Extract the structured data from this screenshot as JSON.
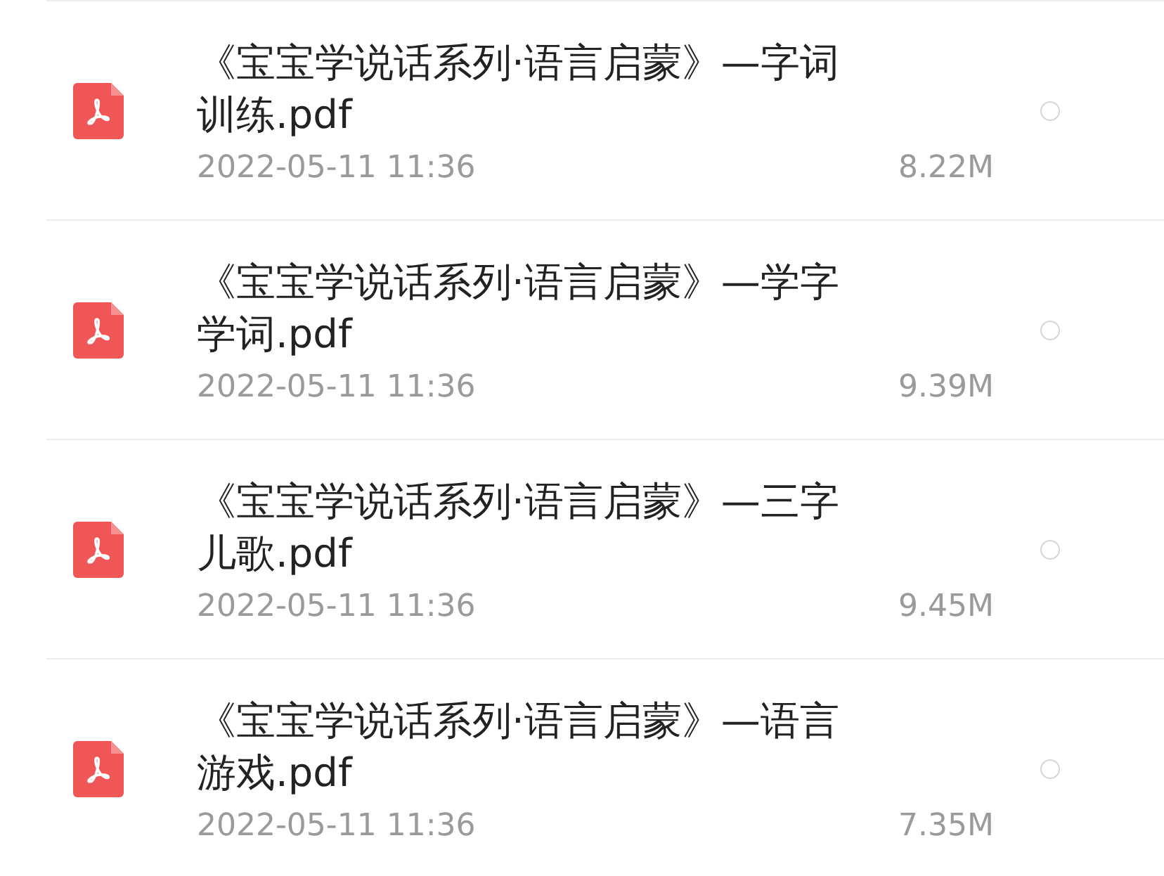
{
  "files": [
    {
      "name": "《宝宝学说话系列·语言启蒙》—字词训练.pdf",
      "date": "2022-05-11 11:36",
      "size": "8.22M",
      "selected": false
    },
    {
      "name": "《宝宝学说话系列·语言启蒙》—学字学词.pdf",
      "date": "2022-05-11 11:36",
      "size": "9.39M",
      "selected": false
    },
    {
      "name": "《宝宝学说话系列·语言启蒙》—三字儿歌.pdf",
      "date": "2022-05-11 11:36",
      "size": "9.45M",
      "selected": false
    },
    {
      "name": "《宝宝学说话系列·语言启蒙》—语言游戏.pdf",
      "date": "2022-05-11 11:36",
      "size": "7.35M",
      "selected": false
    }
  ]
}
